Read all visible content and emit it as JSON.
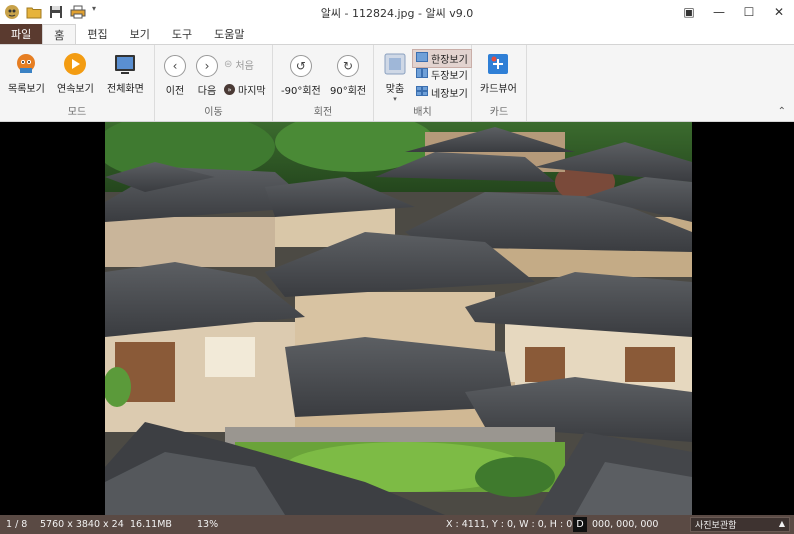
{
  "window": {
    "title": "알씨 - 112824.jpg - 알씨 v9.0",
    "controls": [
      "▣",
      "—",
      "☐",
      "✕"
    ]
  },
  "quick_access": [
    "app-logo-icon",
    "open-folder-icon",
    "save-icon",
    "print-icon",
    "customize-dropdown-icon"
  ],
  "tabs": [
    {
      "label": "파일"
    },
    {
      "label": "홈"
    },
    {
      "label": "편집"
    },
    {
      "label": "보기"
    },
    {
      "label": "도구"
    },
    {
      "label": "도움말"
    }
  ],
  "ribbon": {
    "mode": {
      "label": "모드",
      "list_view": "목록보기",
      "slideshow": "연속보기",
      "fullscreen": "전체화면"
    },
    "navigation": {
      "label": "이동",
      "prev": "이전",
      "next": "다음",
      "first": "처음",
      "last": "마지막"
    },
    "rotate": {
      "label": "회전",
      "ccw": "-90°회전",
      "cw": "90°회전"
    },
    "layout": {
      "label": "배치",
      "fit": "맞춤",
      "single": "한장보기",
      "double": "두장보기",
      "quad": "네장보기"
    },
    "card": {
      "label": "카드",
      "card_viewer": "카드뷰어"
    }
  },
  "colors": {
    "file_tab": "#5a3a2f",
    "statusbar": "#5a4a44",
    "accent_orange": "#f39c12",
    "accent_blue": "#2f7fd6"
  },
  "statusbar": {
    "index": "1 / 8",
    "dimensions": "5760 x 3840 x 24",
    "filesize": "16.11MB",
    "zoom": "13%",
    "coords": "X : 4111, Y : 0, W : 0, H : 0",
    "d_label": "D",
    "rgb": "000, 000, 000",
    "dropdown": "사진보관함"
  }
}
